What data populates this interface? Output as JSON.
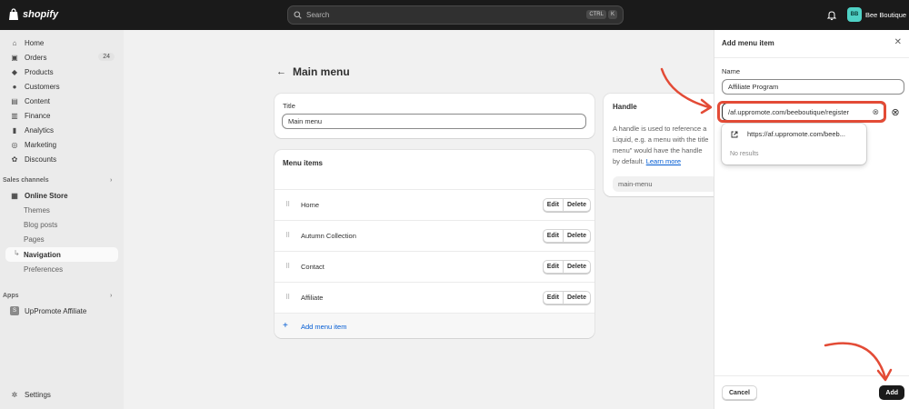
{
  "topbar": {
    "brand": "shopify",
    "search_placeholder": "Search",
    "kbd": [
      "CTRL",
      "K"
    ],
    "store_initials": "BB",
    "store_name": "Bee Boutique"
  },
  "sidebar": {
    "items": [
      {
        "label": "Home",
        "icon": "home-icon"
      },
      {
        "label": "Orders",
        "icon": "orders-icon",
        "badge": "24"
      },
      {
        "label": "Products",
        "icon": "tag-icon"
      },
      {
        "label": "Customers",
        "icon": "person-icon"
      },
      {
        "label": "Content",
        "icon": "content-icon"
      },
      {
        "label": "Finance",
        "icon": "bank-icon"
      },
      {
        "label": "Analytics",
        "icon": "chart-icon"
      },
      {
        "label": "Marketing",
        "icon": "target-icon"
      },
      {
        "label": "Discounts",
        "icon": "discount-icon"
      }
    ],
    "sales_channels_label": "Sales channels",
    "online_store": "Online Store",
    "sub_items": [
      "Themes",
      "Blog posts",
      "Pages",
      "Navigation",
      "Preferences"
    ],
    "apps_label": "Apps",
    "app_item": "UpPromote Affiliate",
    "settings": "Settings"
  },
  "page": {
    "title": "Main menu",
    "title_label": "Title",
    "title_value": "Main menu",
    "menu_items_heading": "Menu items",
    "menu_items": [
      "Home",
      "Autumn Collection",
      "Contact",
      "Affiliate"
    ],
    "edit_label": "Edit",
    "delete_label": "Delete",
    "add_menu_item": "Add menu item"
  },
  "handle": {
    "title": "Handle",
    "desc_lines": [
      "A handle is used to reference a",
      "Liquid, e.g. a menu with the title",
      "menu\" would have the handle",
      "by default."
    ],
    "learn_more": "Learn more",
    "value": "main-menu"
  },
  "drawer": {
    "title": "Add menu item",
    "name_label": "Name",
    "name_value": "Affiliate Program",
    "link_value": "/af.uppromote.com/beeboutique/register",
    "suggestion": "https://af.uppromote.com/beeb...",
    "no_results": "No results",
    "cancel": "Cancel",
    "add": "Add"
  },
  "colors": {
    "annotation": "#e34b36",
    "link": "#005bd3",
    "topbar": "#1a1a1a"
  }
}
